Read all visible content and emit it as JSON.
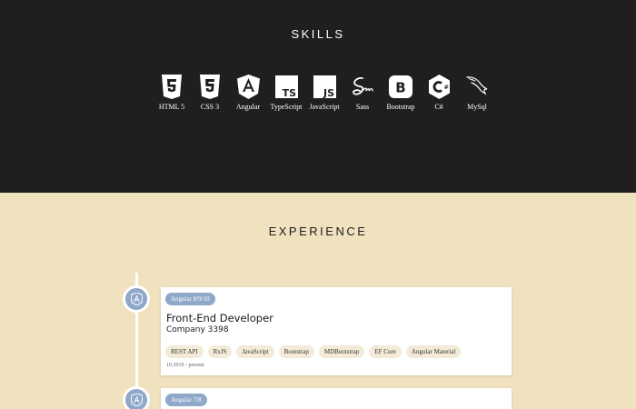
{
  "skills": {
    "title": "SKILLS",
    "items": [
      {
        "label": "HTML 5",
        "icon": "html5-icon"
      },
      {
        "label": "CSS 3",
        "icon": "css3-icon"
      },
      {
        "label": "Angular",
        "icon": "angular-icon"
      },
      {
        "label": "TypeScript",
        "icon": "typescript-icon"
      },
      {
        "label": "JavaScript",
        "icon": "javascript-icon"
      },
      {
        "label": "Sass",
        "icon": "sass-icon"
      },
      {
        "label": "Bootstrap",
        "icon": "bootstrap-icon"
      },
      {
        "label": "C#",
        "icon": "csharp-icon"
      },
      {
        "label": "MySql",
        "icon": "mysql-icon"
      }
    ]
  },
  "experience": {
    "title": "EXPERIENCE",
    "jobs": [
      {
        "version": "Angular 8/9/10",
        "title": "Front-End Developer",
        "company": "Company 3398",
        "tags": [
          "REST API",
          "RxJS",
          "JavaScript",
          "Bootstrap",
          "MDBootstrap",
          "EF Core",
          "Angular Material"
        ],
        "dates": "10.2019 - present"
      },
      {
        "version": "Angular 7/8"
      }
    ]
  },
  "colors": {
    "dark_bg": "#201f1f",
    "light_bg": "#f0e1bf",
    "accent": "#8fa8c9"
  }
}
